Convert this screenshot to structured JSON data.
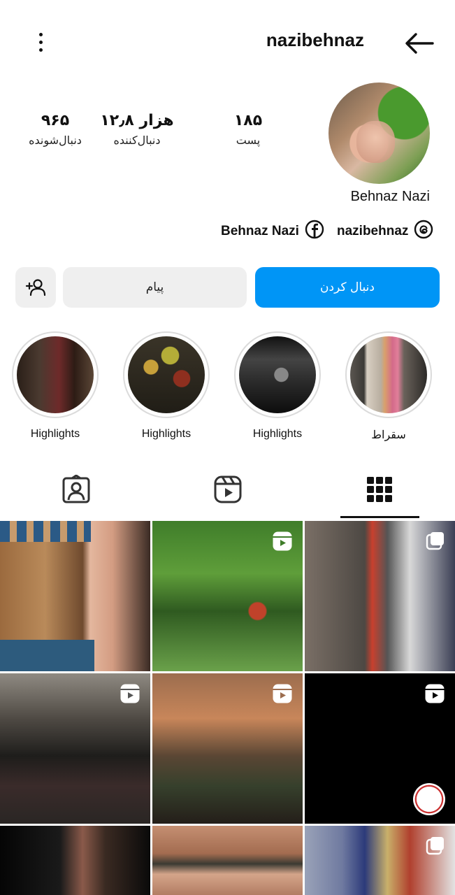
{
  "header": {
    "username": "nazibehnaz"
  },
  "profile": {
    "display_name": "Behnaz Nazi",
    "stats": [
      {
        "key": "posts",
        "value": "۱۸۵",
        "label": "پست"
      },
      {
        "key": "followers",
        "value": "۱۲٫۸ هزار",
        "label": "دنبال‌کننده"
      },
      {
        "key": "following",
        "value": "۹۶۵",
        "label": "دنبال‌شونده"
      }
    ],
    "links": {
      "threads_handle": "nazibehnaz",
      "facebook_name": "Behnaz Nazi"
    }
  },
  "actions": {
    "follow_label": "دنبال کردن",
    "message_label": "پیام"
  },
  "highlights": [
    {
      "label": "سقراط"
    },
    {
      "label": "Highlights"
    },
    {
      "label": "Highlights"
    },
    {
      "label": "Highlights"
    }
  ],
  "tabs": [
    {
      "name": "grid",
      "icon": "grid-icon",
      "active": true
    },
    {
      "name": "reels",
      "icon": "reels-icon",
      "active": false
    },
    {
      "name": "tagged",
      "icon": "tagged-icon",
      "active": false
    }
  ],
  "colors": {
    "accent": "#0095f6",
    "button_bg": "#efefef",
    "text": "#111111"
  },
  "posts": [
    {
      "type": "image",
      "icon": "none"
    },
    {
      "type": "reel",
      "icon": "reels-icon"
    },
    {
      "type": "carousel",
      "icon": "multi-icon"
    },
    {
      "type": "reel",
      "icon": "reels-icon"
    },
    {
      "type": "reel",
      "icon": "reels-icon"
    },
    {
      "type": "reel",
      "icon": "reels-icon"
    },
    {
      "type": "image",
      "icon": "none"
    },
    {
      "type": "image",
      "icon": "none"
    },
    {
      "type": "carousel",
      "icon": "multi-icon"
    }
  ]
}
